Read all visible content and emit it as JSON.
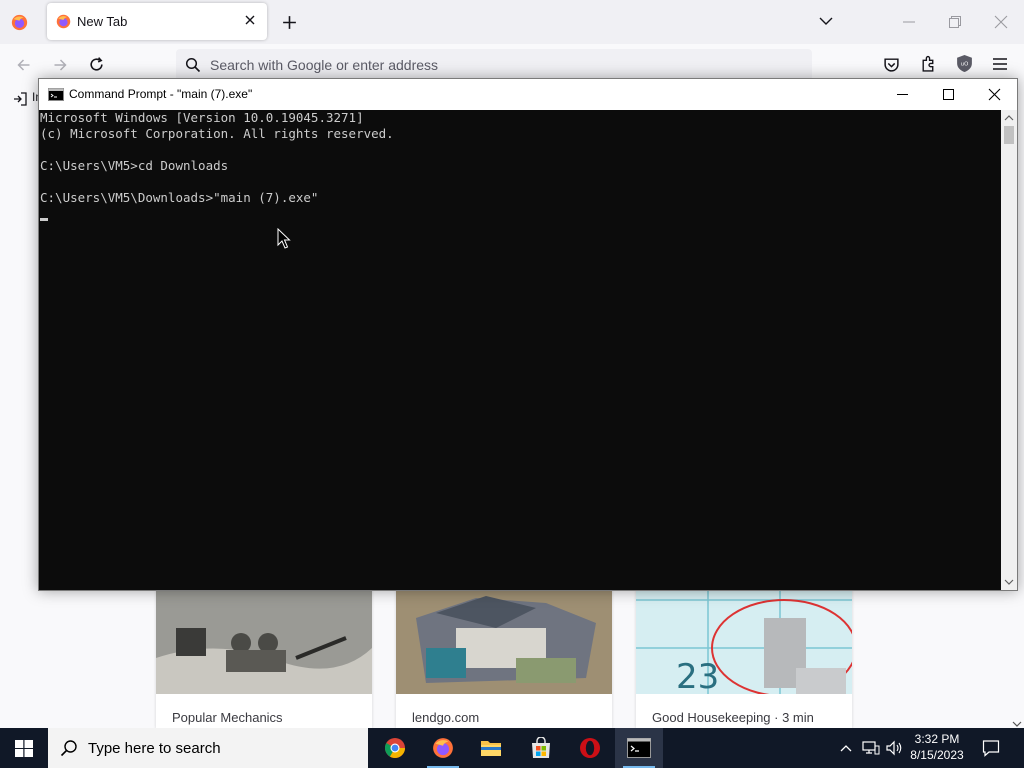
{
  "browser": {
    "tab": {
      "title": "New Tab"
    },
    "url_placeholder": "Search with Google or enter address",
    "bookmark_partial": "Im"
  },
  "page": {
    "cards": [
      {
        "source": "Popular Mechanics"
      },
      {
        "source": "lendgo.com"
      },
      {
        "source": "Good Housekeeping · 3 min"
      }
    ]
  },
  "cmd": {
    "title": "Command Prompt - \"main (7).exe\"",
    "lines": [
      "Microsoft Windows [Version 10.0.19045.3271]",
      "(c) Microsoft Corporation. All rights reserved.",
      "",
      "C:\\Users\\VM5>cd Downloads",
      "",
      "C:\\Users\\VM5\\Downloads>\"main (7).exe\""
    ],
    "background": "#0c0c0c",
    "text_color": "#cccccc"
  },
  "taskbar": {
    "search_placeholder": "Type here to search",
    "apps": [
      "chrome-icon",
      "firefox-icon",
      "file-explorer-icon",
      "microsoft-store-icon",
      "opera-icon",
      "command-prompt-icon"
    ],
    "time": "3:32 PM",
    "date": "8/15/2023",
    "accent": "#76b9ed"
  }
}
